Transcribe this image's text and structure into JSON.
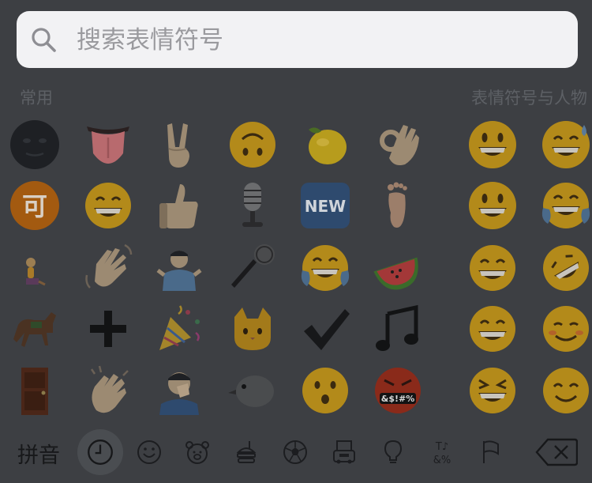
{
  "search": {
    "placeholder": "搜索表情符号"
  },
  "sections": {
    "recent": "常用",
    "people": "表情符号与人物"
  },
  "bottom_bar": {
    "input_mode": "拼音",
    "categories": [
      {
        "icon": "clock-icon",
        "active": true
      },
      {
        "icon": "smiley-icon",
        "active": false
      },
      {
        "icon": "bear-icon",
        "active": false
      },
      {
        "icon": "food-icon",
        "active": false
      },
      {
        "icon": "soccer-ball-icon",
        "active": false
      },
      {
        "icon": "building-icon",
        "active": false
      },
      {
        "icon": "lightbulb-icon",
        "active": false
      },
      {
        "icon": "symbols-icon",
        "active": false
      },
      {
        "icon": "flag-icon",
        "active": false
      }
    ],
    "symbols_glyph_top": "T♪",
    "symbols_glyph_bottom": "&%"
  },
  "emoji_labels": {
    "ke": "可",
    "new": "NEW",
    "grawlix": "&$!#%"
  },
  "emoji_rows": [
    [
      "black-full-moon-face",
      "tongue",
      "victory-hand",
      "upside-down-face",
      "lemon",
      "ok-hand",
      "grinning-face",
      "grinning-sweat"
    ],
    [
      "ideograph-ke",
      "grinning-smile",
      "thumbs-up",
      "studio-microphone",
      "new-button",
      "foot",
      "grinning-face",
      "joy"
    ],
    [
      "person-kneeling",
      "waving-hand",
      "person-shrugging",
      "microphone",
      "joy",
      "watermelon",
      "grinning-smile",
      "rofl"
    ],
    [
      "horse",
      "plus-sign",
      "party-popper",
      "cat-face",
      "check-mark",
      "musical-notes",
      "grinning-smile",
      "relaxed"
    ],
    [
      "door",
      "clapping-hands",
      "face-palm",
      "bird",
      "hushed-face",
      "cursing-face",
      "squinting-laugh",
      "smiling-face"
    ]
  ]
}
